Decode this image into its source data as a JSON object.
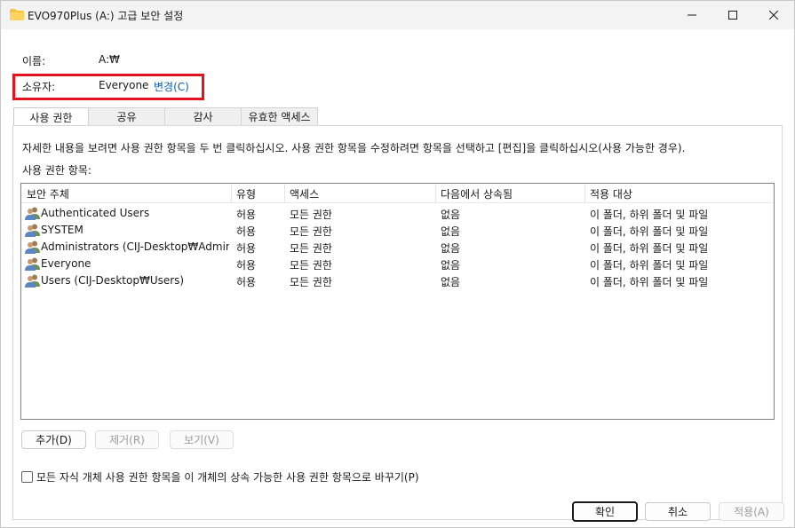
{
  "window": {
    "title": "EVO970Plus (A:) 고급 보안 설정"
  },
  "general": {
    "name_label": "이름:",
    "name_value": "A:₩",
    "owner_label": "소유자:",
    "owner_value": "Everyone",
    "owner_change_link": "변경(C)"
  },
  "tabs": [
    {
      "label": "사용 권한",
      "active": true
    },
    {
      "label": "공유",
      "active": false
    },
    {
      "label": "감사",
      "active": false
    },
    {
      "label": "유효한 액세스",
      "active": false
    }
  ],
  "permissions": {
    "instructions": "자세한 내용을 보려면 사용 권한 항목을 두 번 클릭하십시오. 사용 권한 항목을 수정하려면 항목을 선택하고 [편집]을 클릭하십시오(사용 가능한 경우).",
    "entries_label": "사용 권한 항목:",
    "columns": [
      "보안 주체",
      "유형",
      "액세스",
      "다음에서 상속됨",
      "적용 대상"
    ],
    "rows": [
      {
        "principal": "Authenticated Users",
        "type": "허용",
        "access": "모든 권한",
        "inherited": "없음",
        "applies_to": "이 폴더, 하위 폴더 및 파일"
      },
      {
        "principal": "SYSTEM",
        "type": "허용",
        "access": "모든 권한",
        "inherited": "없음",
        "applies_to": "이 폴더, 하위 폴더 및 파일"
      },
      {
        "principal": "Administrators (CIJ-Desktop₩Adminis...",
        "type": "허용",
        "access": "모든 권한",
        "inherited": "없음",
        "applies_to": "이 폴더, 하위 폴더 및 파일"
      },
      {
        "principal": "Everyone",
        "type": "허용",
        "access": "모든 권한",
        "inherited": "없음",
        "applies_to": "이 폴더, 하위 폴더 및 파일"
      },
      {
        "principal": "Users (CIJ-Desktop₩Users)",
        "type": "허용",
        "access": "모든 권한",
        "inherited": "없음",
        "applies_to": "이 폴더, 하위 폴더 및 파일"
      }
    ],
    "add_button": "추가(D)",
    "remove_button": "제거(R)",
    "view_button": "보기(V)",
    "replace_checkbox_label": "모든 자식 개체 사용 권한 항목을 이 개체의 상속 가능한 사용 권한 항목으로 바꾸기(P)"
  },
  "footer": {
    "ok_button": "확인",
    "cancel_button": "취소",
    "apply_button": "적용(A)"
  },
  "colors": {
    "highlight_box": "#e0141e",
    "link": "#0b5cad",
    "folder_icon": "#f5c342"
  },
  "icons": [
    "folder-icon",
    "minimize-icon",
    "maximize-icon",
    "close-icon",
    "user-group-icon"
  ]
}
